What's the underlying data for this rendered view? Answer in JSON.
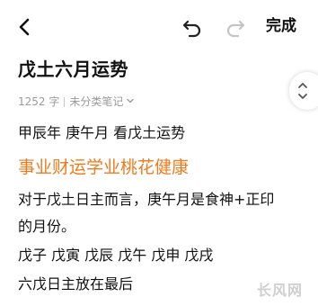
{
  "toolbar": {
    "done_label": "完成",
    "back_icon": "chevron-left-icon",
    "undo_icon": "undo-icon",
    "redo_icon": "redo-icon"
  },
  "note": {
    "title": "戊土六月运势",
    "word_count": "1252 字",
    "category": "未分类笔记",
    "lines": [
      "甲辰年 庚午月 看戊土运势",
      "事业财运学业桃花健康",
      "对于戊土日主而言，庚午月是食神+正印",
      "的月份。",
      "戊子 戊寅 戊辰 戊午 戊申 戊戌",
      "六戊日主放在最后"
    ]
  },
  "watermark": "长风网",
  "colors": {
    "headline": "#f07a1c",
    "meta_text": "#9a9a9a",
    "redo_disabled": "#c4c4c4"
  }
}
